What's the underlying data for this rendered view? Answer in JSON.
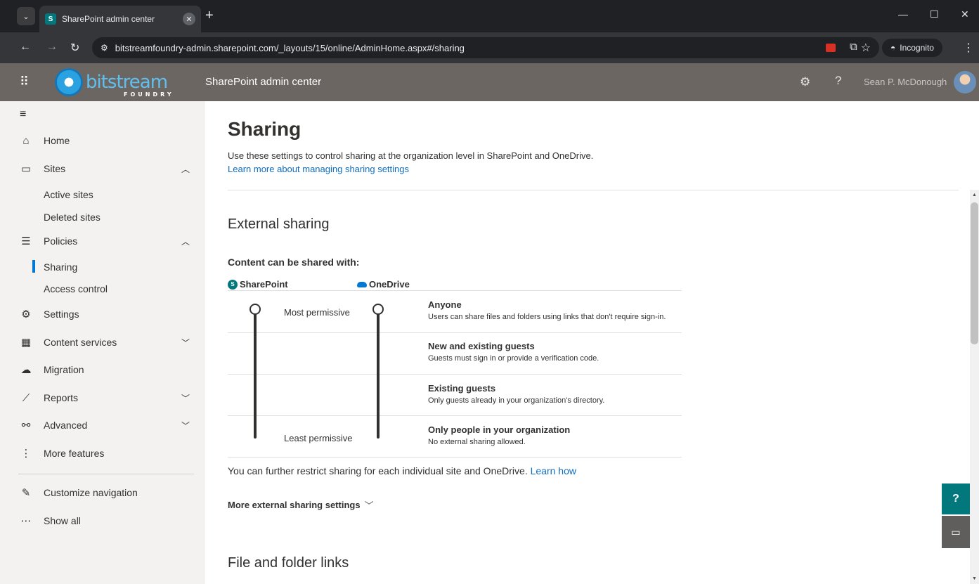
{
  "browser": {
    "tab_title": "SharePoint admin center",
    "url": "bitstreamfoundry-admin.sharepoint.com/_layouts/15/online/AdminHome.aspx#/sharing",
    "incognito_label": "Incognito"
  },
  "suite": {
    "logo_text": "bitstream",
    "logo_sub": "FOUNDRY",
    "title": "SharePoint admin center",
    "user_name": "Sean P. McDonough"
  },
  "nav": {
    "home": "Home",
    "sites": "Sites",
    "active_sites": "Active sites",
    "deleted_sites": "Deleted sites",
    "policies": "Policies",
    "sharing": "Sharing",
    "access_control": "Access control",
    "settings": "Settings",
    "content_services": "Content services",
    "migration": "Migration",
    "reports": "Reports",
    "advanced": "Advanced",
    "more_features": "More features",
    "customize_navigation": "Customize navigation",
    "show_all": "Show all"
  },
  "main": {
    "title": "Sharing",
    "description": "Use these settings to control sharing at the organization level in SharePoint and OneDrive.",
    "learn_more": "Learn more about managing sharing settings",
    "external_sharing": "External sharing",
    "content_shared_with": "Content can be shared with:",
    "sharepoint_label": "SharePoint",
    "onedrive_label": "OneDrive",
    "most_permissive": "Most permissive",
    "least_permissive": "Least permissive",
    "options": [
      {
        "title": "Anyone",
        "desc": "Users can share files and folders using links that don't require sign-in."
      },
      {
        "title": "New and existing guests",
        "desc": "Guests must sign in or provide a verification code."
      },
      {
        "title": "Existing guests",
        "desc": "Only guests already in your organization's directory."
      },
      {
        "title": "Only people in your organization",
        "desc": "No external sharing allowed."
      }
    ],
    "further_text": "You can further restrict sharing for each individual site and OneDrive.",
    "learn_how": "Learn how",
    "more_settings": "More external sharing settings",
    "file_folder_links": "File and folder links"
  },
  "colors": {
    "accent": "#0078d4",
    "suite_bar": "#6b6661",
    "teal": "#03787c"
  }
}
